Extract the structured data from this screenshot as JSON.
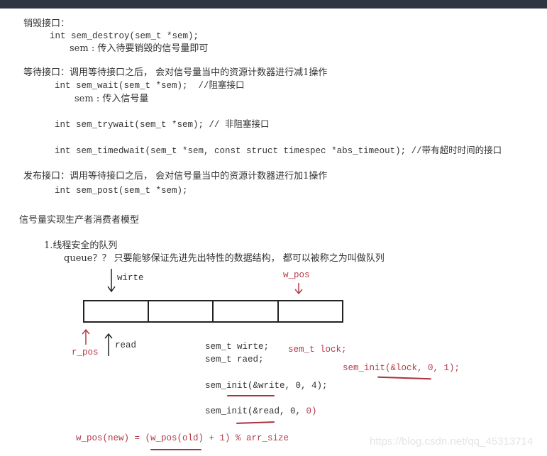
{
  "destroy": {
    "heading": "销毁接口：",
    "signature": "int sem_destroy(sem_t *sem);",
    "param": "sem : 传入待要销毁的信号量即可"
  },
  "wait": {
    "heading": "等待接口：调用等待接口之后， 会对信号量当中的资源计数器进行减1操作",
    "sem_wait": "int sem_wait(sem_t *sem);  //阻塞接口",
    "param": "sem : 传入信号量",
    "sem_trywait": "int sem_trywait(sem_t *sem); // 非阻塞接口",
    "sem_timedwait": "int sem_timedwait(sem_t *sem, const struct timespec *abs_timeout); //带有超时时间的接口"
  },
  "post": {
    "heading": "发布接口：调用等待接口之后， 会对信号量当中的资源计数器进行加1操作",
    "signature": "int sem_post(sem_t *sem);"
  },
  "model": {
    "heading": "信号量实现生产者消费者模型",
    "item1": "1.线程安全的队列",
    "queue_desc": "queue？？ 只要能够保证先进先出特性的数据结构， 都可以被称之为叫做队列"
  },
  "diagram": {
    "cells": 4,
    "write_label": "wirte",
    "w_pos_label": "w_pos",
    "r_pos_label": "r_pos",
    "read_label": "read",
    "decl_write": "sem_t wirte;",
    "decl_read": "sem_t raed;",
    "decl_lock": "sem_t lock;",
    "init_lock": "sem_init(&lock, 0, 1);",
    "init_write": "sem_init(&write, 0, 4);",
    "init_read_prefix": "sem_init(&read, 0, ",
    "init_read_value": "0)",
    "formula": "w_pos(new) = (w_pos(old) + 1) % arr_size"
  },
  "colors": {
    "annotation_red": "#b23a48",
    "topbar": "#2e3441"
  },
  "watermark": "https://blog.csdn.net/qq_45313714"
}
